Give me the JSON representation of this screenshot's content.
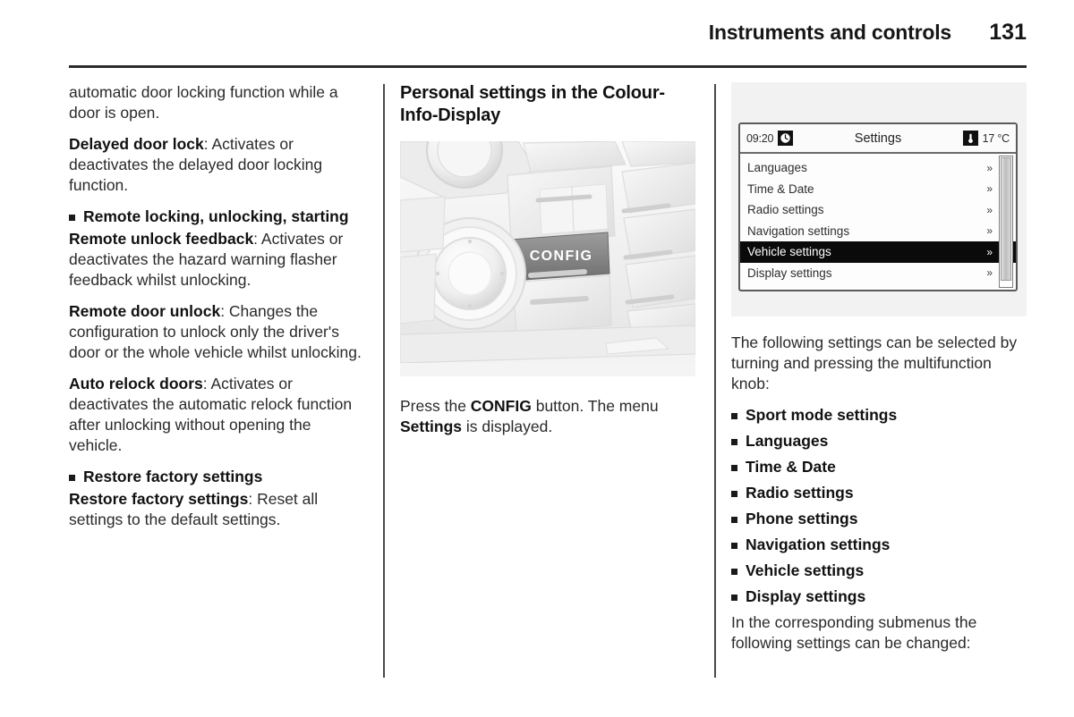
{
  "header": {
    "title": "Instruments and controls",
    "page_number": "131"
  },
  "left_column": {
    "continuation_text": "automatic door locking function while a door is open.",
    "delayed_lock": {
      "term": "Delayed door lock",
      "description": ": Activates or deactivates the delayed door locking function."
    },
    "remote_heading": "Remote locking, unlocking, starting",
    "remote_unlock_feedback": {
      "term": "Remote unlock feedback",
      "description": ": Activates or deactivates the hazard warning flasher feedback whilst unlocking."
    },
    "remote_door_unlock": {
      "term": "Remote door unlock",
      "description": ": Changes the configuration to unlock only the driver's door or the whole vehicle whilst unlocking."
    },
    "auto_relock_doors": {
      "term": "Auto relock doors",
      "description": ": Activates or deactivates the automatic relock function after unlocking without opening the vehicle."
    },
    "restore_heading": "Restore factory settings",
    "restore_factory": {
      "term": "Restore factory settings",
      "description": ": Reset all settings to the default settings."
    }
  },
  "middle_column": {
    "heading": "Personal settings in the Colour-Info-Display",
    "photo_button_label": "CONFIG",
    "caption": {
      "part1": "Press the ",
      "bold1": "CONFIG",
      "part2": " button. The menu ",
      "bold2": "Settings",
      "part3": " is displayed."
    }
  },
  "right_column": {
    "display": {
      "status_time": "09:20",
      "status_title": "Settings",
      "status_temperature": "17 °C",
      "clock_icon": "clock-icon",
      "thermometer_icon": "thermometer-icon",
      "menu_items": [
        {
          "label": "Languages",
          "selected": false,
          "arrow": "»"
        },
        {
          "label": "Time & Date",
          "selected": false,
          "arrow": "»"
        },
        {
          "label": "Radio settings",
          "selected": false,
          "arrow": "»"
        },
        {
          "label": "Navigation settings",
          "selected": false,
          "arrow": "»"
        },
        {
          "label": "Vehicle settings",
          "selected": true,
          "arrow": "»"
        },
        {
          "label": "Display settings",
          "selected": false,
          "arrow": "»"
        }
      ]
    },
    "intro_text": "The following settings can be selected by turning and pressing the multifunction knob:",
    "settings_list": [
      "Sport mode settings",
      "Languages",
      "Time & Date",
      "Radio settings",
      "Phone settings",
      "Navigation settings",
      "Vehicle settings",
      "Display settings"
    ],
    "closing_text": "In the corresponding submenus the following settings can be changed:"
  }
}
